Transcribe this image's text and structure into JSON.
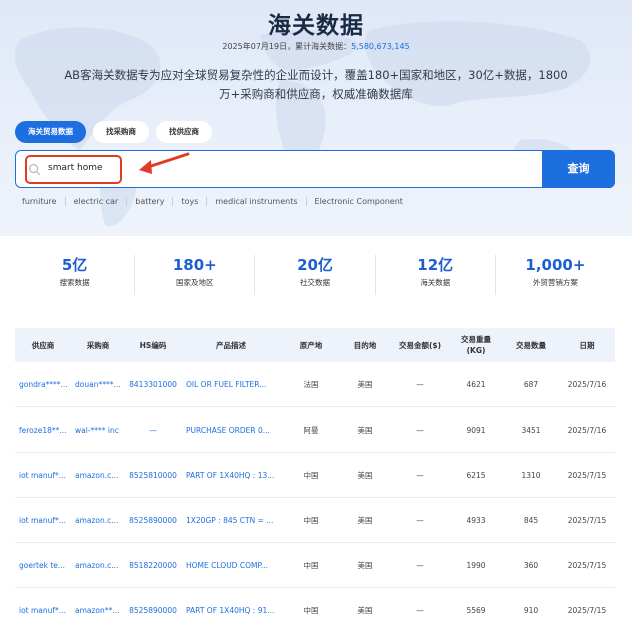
{
  "header": {
    "title": "海关数据",
    "stat_date": "2025年07月19日，累计海关数据：",
    "stat_count": "5,580,673,145",
    "description": "AB客海关数据专为应对全球贸易复杂性的企业而设计，覆盖180+国家和地区，30亿+数据，1800万+采购商和供应商，权威准确数据库"
  },
  "tabs": [
    {
      "label": "海关贸易数据",
      "active": true
    },
    {
      "label": "找采购商",
      "active": false
    },
    {
      "label": "找供应商",
      "active": false
    }
  ],
  "search": {
    "value": "smart home",
    "button_label": "查询"
  },
  "hot_keywords": [
    "furniture",
    "electric car",
    "battery",
    "toys",
    "medical instruments",
    "Electronic Component"
  ],
  "metrics": [
    {
      "value": "5亿",
      "label": "搜索数据"
    },
    {
      "value": "180+",
      "label": "国家及地区"
    },
    {
      "value": "20亿",
      "label": "社交数据"
    },
    {
      "value": "12亿",
      "label": "海关数据"
    },
    {
      "value": "1,000+",
      "label": "外贸营销方案"
    }
  ],
  "table": {
    "headers": [
      "供应商",
      "采购商",
      "HS编码",
      "产品描述",
      "原产地",
      "目的地",
      "交易金额($)",
      "交易重量(KG)",
      "交易数量",
      "日期"
    ],
    "rows": [
      [
        "gondra****...",
        "douan****...",
        "8413301000",
        "OIL OR FUEL FILTER...",
        "法国",
        "美国",
        "—",
        "4621",
        "687",
        "2025/7/16"
      ],
      [
        "feroze18**...",
        "wal-**** inc",
        "—",
        "PURCHASE ORDER 0...",
        "阿曼",
        "美国",
        "—",
        "9091",
        "3451",
        "2025/7/16"
      ],
      [
        "iot manuf*...",
        "amazon.c...",
        "8525810000",
        "PART OF 1X40HQ : 13...",
        "中国",
        "美国",
        "—",
        "6215",
        "1310",
        "2025/7/15"
      ],
      [
        "iot manuf*...",
        "amazon.c...",
        "8525890000",
        "1X20GP : 845 CTN = ...",
        "中国",
        "美国",
        "—",
        "4933",
        "845",
        "2025/7/15"
      ],
      [
        "goertek te...",
        "amazon.c...",
        "8518220000",
        "HOME CLOUD COMP...",
        "中国",
        "美国",
        "—",
        "1990",
        "360",
        "2025/7/15"
      ],
      [
        "iot manuf*...",
        "amazon**...",
        "8525890000",
        "PART OF 1X40HQ : 91...",
        "中国",
        "美国",
        "—",
        "5569",
        "910",
        "2025/7/15"
      ]
    ]
  },
  "colors": {
    "accent": "#1d6fe0",
    "annotation": "#e23b24"
  }
}
